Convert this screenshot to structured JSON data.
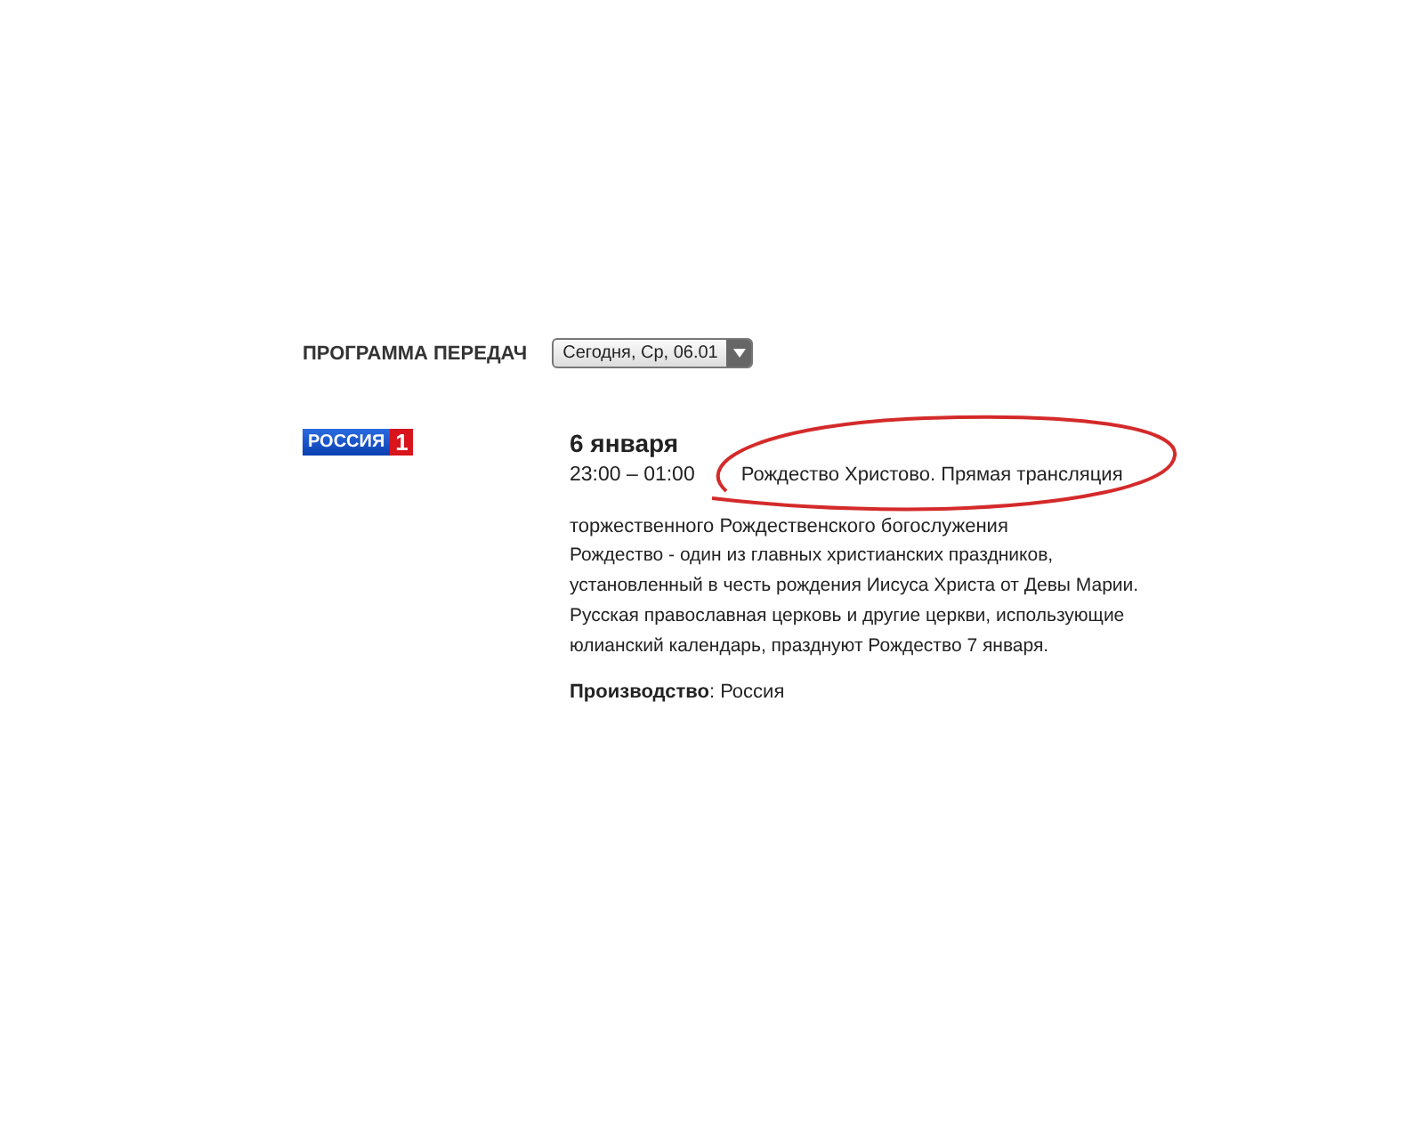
{
  "header": {
    "title": "ПРОГРАММА ПЕРЕДАЧ",
    "day_select": {
      "value": "Сегодня, Ср, 06.01"
    }
  },
  "channel": {
    "logo_name": "РОССИЯ",
    "logo_number": "1"
  },
  "program": {
    "date": "6 января",
    "time": "23:00 – 01:00",
    "title": "Рождество Христово. Прямая трансляция",
    "title_continued": "торжественного Рождественского богослужения",
    "description": "Рождество - один из главных христианских праздников, установленный в честь рождения Иисуса Христа от Девы Марии. Русская православная церковь и другие церкви, использующие юлианский календарь, празднуют Рождество 7 января.",
    "production_label": "Производство",
    "production_separator": ":",
    "production_value": "Россия"
  }
}
